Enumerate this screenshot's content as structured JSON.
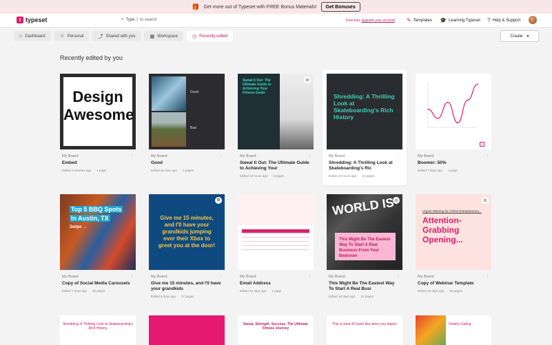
{
  "banner": {
    "text": "Get more out of Typeset with FREE Bonus Materials!",
    "button": "Get Bonuses"
  },
  "topbar": {
    "logo": "typeset",
    "search_type": "Type",
    "search_sep": "/",
    "search_placeholder": "to search",
    "trial_text": "Free trial,",
    "trial_link": "upgrade your account",
    "templates": "Templates",
    "learning": "Learning Typeset",
    "help": "Help & Support"
  },
  "filters": [
    {
      "label": "Dashboard",
      "icon": "home-icon"
    },
    {
      "label": "Personal",
      "icon": "user-icon"
    },
    {
      "label": "Shared with you",
      "icon": "share-icon"
    },
    {
      "label": "Workspace",
      "icon": "building-icon"
    },
    {
      "label": "Recently edited",
      "icon": "clock-icon",
      "active": true
    }
  ],
  "create_label": "Create",
  "section_title": "Recently edited by you",
  "cards": [
    {
      "brand": "My Brand",
      "title": "Embed",
      "edited": "Edited 3 minutes ago",
      "pages": "1 page"
    },
    {
      "brand": "My Brand",
      "title": "Good",
      "edited": "Edited an hour ago",
      "pages": "4 pages"
    },
    {
      "brand": "My Brand",
      "title": "Sweat It Out: The Ultimate Guide to Achieving Your",
      "edited": "Edited 19 hours ago",
      "pages": "3 pages"
    },
    {
      "brand": "My Brand",
      "title": "Shredding: A Thrilling Look at Skateboarding's Ric",
      "edited": "Edited 20 hours ago",
      "pages": "10 pages"
    },
    {
      "brand": "My Brand",
      "title": "Boomer: 50%",
      "edited": "Edited 7 days ago",
      "pages": "1 page"
    },
    {
      "brand": "My Brand",
      "title": "Copy of Social Media Carousels",
      "edited": "Edited 7 days ago",
      "pages": "25 pages"
    },
    {
      "brand": "My Brand",
      "title": "Give me 15 minutes, and I'll have your grandkids",
      "edited": "Edited 8 days ago",
      "pages": "17 pages"
    },
    {
      "brand": "My Brand",
      "title": "Email Address",
      "edited": "Edited 15 days ago",
      "pages": "1 page"
    },
    {
      "brand": "My Brand",
      "title": "This Might Be The Easiest Way To Start A Real Busi",
      "edited": "Edited 16 days ago",
      "pages": "24 pages"
    },
    {
      "brand": "My Brand",
      "title": "Copy of Webinar Template",
      "edited": "Edited 19 days ago",
      "pages": "50 pages"
    }
  ],
  "thumbs": {
    "design": "Design Awesome",
    "good_top": "Good",
    "good_bottom": "Bad",
    "sweat": "Sweat It Out: The Ultimate Guide to Achieving Your Fitness Goals",
    "shred": "Shredding: A Thrilling Look at Skateboarding's Rich History",
    "bbq_1": "Top 5 BBQ Spots",
    "bbq_2": "In Austin, TX",
    "bbq_3": "Swipe →",
    "give": "Give me 15 minutes, and I'll have your grandkids jumping over their Xbox to greet you at the door!",
    "world": "WORLD IS",
    "easiest": "This Might Be The Easiest Way To Start A Real Business From Your Bedroom",
    "webinar_small": "Urgent Warning for Online Entrepreneurs...",
    "webinar_big": "Attention-Grabbing Opening..."
  },
  "row3": {
    "a": "Shredding: A Thrilling Look at Skateboarding's Rich History",
    "c": "Sweat, Strength, Success: The Ultimate Fitness Journey",
    "d": "This is what it'll looks like when you import",
    "e": "Healthy Eating"
  },
  "chart_data": {
    "type": "line",
    "note": "boomer thumbnail mini chart",
    "values": [
      40,
      20,
      55,
      10,
      60,
      95
    ]
  }
}
